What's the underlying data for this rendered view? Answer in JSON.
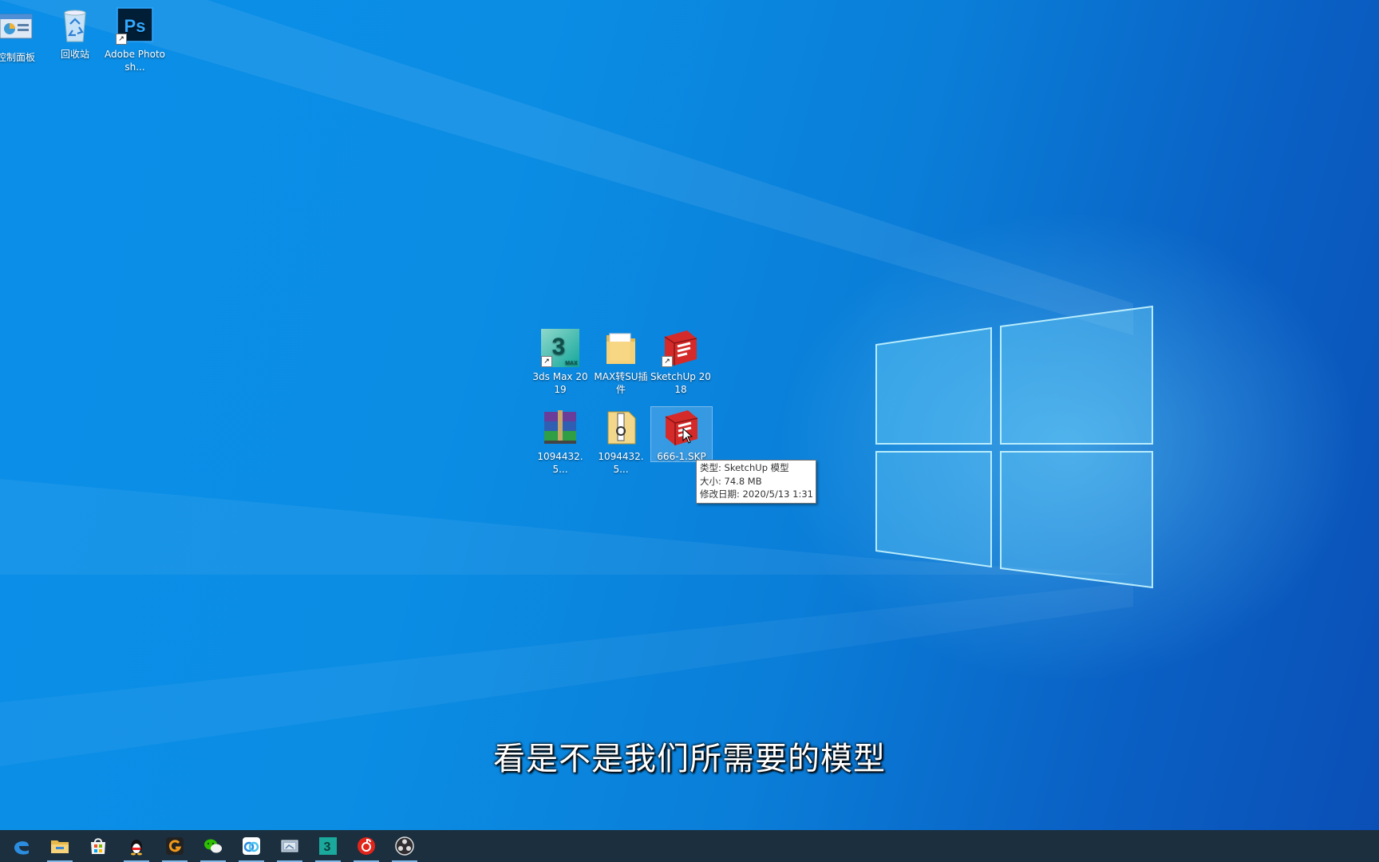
{
  "desktop": {
    "icons": [
      {
        "label": "控制面板",
        "icon": "control-panel-icon"
      },
      {
        "label": "回收站",
        "icon": "recycle-bin-icon"
      },
      {
        "label": "Adobe Photosh...",
        "icon": "photoshop-icon"
      },
      {
        "label": "3ds Max 2019",
        "icon": "3dsmax-icon"
      },
      {
        "label": "MAX转SU插件",
        "icon": "folder-icon"
      },
      {
        "label": "SketchUp 2018",
        "icon": "sketchup-icon"
      },
      {
        "label": "1094432.5...",
        "icon": "winrar-archive-icon"
      },
      {
        "label": "1094432.5...",
        "icon": "zip-file-icon"
      },
      {
        "label": "666-1.SKP",
        "icon": "skp-file-icon"
      }
    ],
    "ps_glyph": "Ps",
    "max_glyph": "3",
    "max_sub": "MAX"
  },
  "tooltip": {
    "type": "类型: SketchUp 模型",
    "size": "大小: 74.8 MB",
    "modified": "修改日期: 2020/5/13 1:31"
  },
  "subtitle": "看是不是我们所需要的模型",
  "taskbar": {
    "items": [
      {
        "icon": "edge-icon",
        "running": false
      },
      {
        "icon": "file-explorer-icon",
        "running": true
      },
      {
        "icon": "store-icon",
        "running": false
      },
      {
        "icon": "qq-icon",
        "running": true
      },
      {
        "icon": "g-app-icon",
        "running": true
      },
      {
        "icon": "wechat-icon",
        "running": true
      },
      {
        "icon": "baidu-netdisk-icon",
        "running": true
      },
      {
        "icon": "screenshot-tool-icon",
        "running": true
      },
      {
        "icon": "3dsmax-taskbar-icon",
        "running": true
      },
      {
        "icon": "netease-music-icon",
        "running": true
      },
      {
        "icon": "obs-icon",
        "running": true
      }
    ]
  },
  "colors": {
    "desktop_blue": "#0a8ee8",
    "taskbar": "#1c2f3f",
    "sketchup_red": "#d42a2a",
    "ps_blue": "#31a8ff"
  }
}
